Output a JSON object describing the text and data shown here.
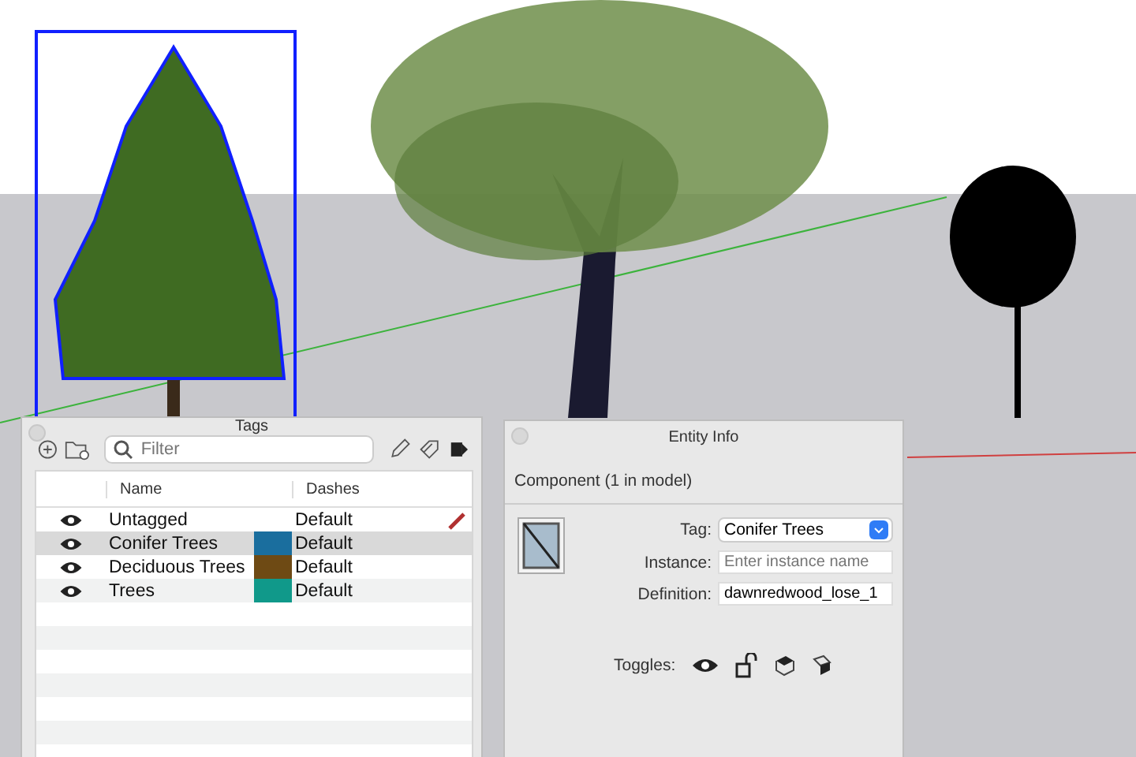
{
  "tags_panel": {
    "title": "Tags",
    "filter": {
      "placeholder": "Filter"
    },
    "columns": [
      "Name",
      "Dashes"
    ],
    "rows": [
      {
        "name": "Untagged",
        "dashes": "Default",
        "visible": true,
        "selected": false,
        "active": true
      },
      {
        "name": "Conifer Trees",
        "dashes": "Default",
        "visible": true,
        "selected": true,
        "active": false,
        "color": "#1a6e9e"
      },
      {
        "name": "Deciduous Trees",
        "dashes": "Default",
        "visible": true,
        "selected": false,
        "active": false,
        "color": "#6e4a14"
      },
      {
        "name": "Trees",
        "dashes": "Default",
        "visible": true,
        "selected": false,
        "active": false,
        "color": "#10998a"
      }
    ]
  },
  "entity_info": {
    "title": "Entity Info",
    "header": "Component (1 in model)",
    "tag": {
      "label": "Tag:",
      "value": "Conifer Trees"
    },
    "instance": {
      "label": "Instance:",
      "placeholder": "Enter instance name"
    },
    "definition": {
      "label": "Definition:",
      "value": "dawnredwood_lose_1"
    },
    "toggles": {
      "label": "Toggles:"
    }
  }
}
